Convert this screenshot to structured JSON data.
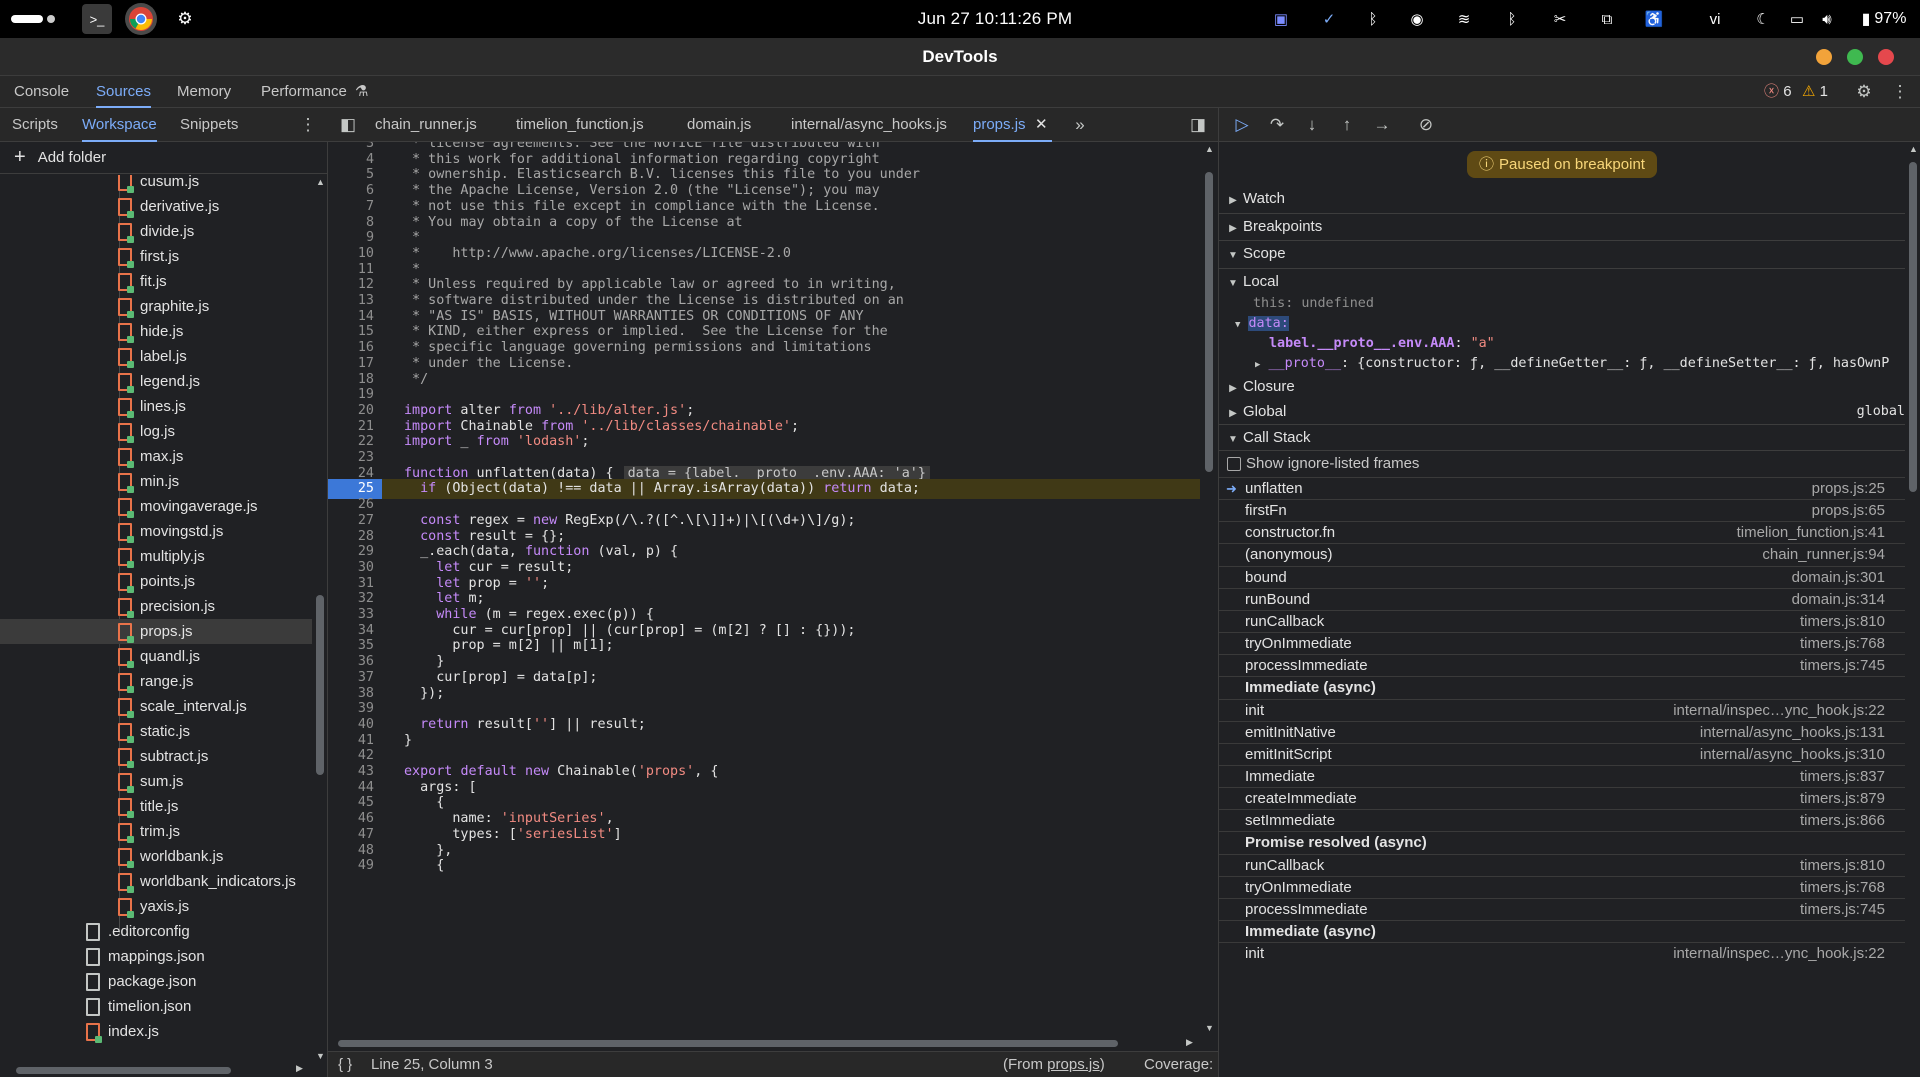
{
  "topbar": {
    "clock": "Jun 27  10:11:26 PM",
    "keyboard_layout": "vi",
    "battery": "97%"
  },
  "window": {
    "title": "DevTools",
    "colors": {
      "minimize": "#f2a33a",
      "maximize": "#3fb950",
      "close": "#e5484d"
    }
  },
  "main_tabs": [
    "Console",
    "Sources",
    "Memory",
    "Performance"
  ],
  "active_main_tab": "Sources",
  "counters": {
    "errors": "6",
    "warnings": "1"
  },
  "navigator": {
    "tabs": [
      "Scripts",
      "Workspace",
      "Snippets"
    ],
    "active_tab": "Workspace",
    "add_folder": "Add folder",
    "files": [
      {
        "name": "cusum.js",
        "type": "js"
      },
      {
        "name": "derivative.js",
        "type": "js"
      },
      {
        "name": "divide.js",
        "type": "js"
      },
      {
        "name": "first.js",
        "type": "js"
      },
      {
        "name": "fit.js",
        "type": "js"
      },
      {
        "name": "graphite.js",
        "type": "js"
      },
      {
        "name": "hide.js",
        "type": "js"
      },
      {
        "name": "label.js",
        "type": "js"
      },
      {
        "name": "legend.js",
        "type": "js"
      },
      {
        "name": "lines.js",
        "type": "js"
      },
      {
        "name": "log.js",
        "type": "js"
      },
      {
        "name": "max.js",
        "type": "js"
      },
      {
        "name": "min.js",
        "type": "js"
      },
      {
        "name": "movingaverage.js",
        "type": "js"
      },
      {
        "name": "movingstd.js",
        "type": "js"
      },
      {
        "name": "multiply.js",
        "type": "js"
      },
      {
        "name": "points.js",
        "type": "js"
      },
      {
        "name": "precision.js",
        "type": "js"
      },
      {
        "name": "props.js",
        "type": "js",
        "selected": true
      },
      {
        "name": "quandl.js",
        "type": "js"
      },
      {
        "name": "range.js",
        "type": "js"
      },
      {
        "name": "scale_interval.js",
        "type": "js"
      },
      {
        "name": "static.js",
        "type": "js"
      },
      {
        "name": "subtract.js",
        "type": "js"
      },
      {
        "name": "sum.js",
        "type": "js"
      },
      {
        "name": "title.js",
        "type": "js"
      },
      {
        "name": "trim.js",
        "type": "js"
      },
      {
        "name": "worldbank.js",
        "type": "js"
      },
      {
        "name": "worldbank_indicators.js",
        "type": "js"
      },
      {
        "name": "yaxis.js",
        "type": "js"
      },
      {
        "name": ".editorconfig",
        "type": "plain"
      },
      {
        "name": "mappings.json",
        "type": "plain"
      },
      {
        "name": "package.json",
        "type": "plain"
      },
      {
        "name": "timelion.json",
        "type": "plain"
      },
      {
        "name": "index.js",
        "type": "js"
      }
    ]
  },
  "editor": {
    "tabs": [
      "chain_runner.js",
      "timelion_function.js",
      "domain.js",
      "internal/async_hooks.js",
      "props.js"
    ],
    "active_tab": "props.js",
    "breakpoint_line": 25,
    "status": {
      "position": "Line 25, Column 3",
      "from_prefix": "(From ",
      "from_file": "props.js",
      "from_suffix": ")",
      "coverage": "Coverage: n/a"
    },
    "lines": [
      {
        "n": "3",
        "t": " * license agreements. See the NOTICE file distributed with",
        "c": "cm"
      },
      {
        "n": "4",
        "t": " * this work for additional information regarding copyright",
        "c": "cm"
      },
      {
        "n": "5",
        "t": " * ownership. Elasticsearch B.V. licenses this file to you under",
        "c": "cm"
      },
      {
        "n": "6",
        "t": " * the Apache License, Version 2.0 (the \"License\"); you may",
        "c": "cm"
      },
      {
        "n": "7",
        "t": " * not use this file except in compliance with the License.",
        "c": "cm"
      },
      {
        "n": "8",
        "t": " * You may obtain a copy of the License at",
        "c": "cm"
      },
      {
        "n": "9",
        "t": " *",
        "c": "cm"
      },
      {
        "n": "10",
        "t": " *    http://www.apache.org/licenses/LICENSE-2.0",
        "c": "cm"
      },
      {
        "n": "11",
        "t": " *",
        "c": "cm"
      },
      {
        "n": "12",
        "t": " * Unless required by applicable law or agreed to in writing,",
        "c": "cm"
      },
      {
        "n": "13",
        "t": " * software distributed under the License is distributed on an",
        "c": "cm"
      },
      {
        "n": "14",
        "t": " * \"AS IS\" BASIS, WITHOUT WARRANTIES OR CONDITIONS OF ANY",
        "c": "cm"
      },
      {
        "n": "15",
        "t": " * KIND, either express or implied.  See the License for the",
        "c": "cm"
      },
      {
        "n": "16",
        "t": " * specific language governing permissions and limitations",
        "c": "cm"
      },
      {
        "n": "17",
        "t": " * under the License.",
        "c": "cm"
      },
      {
        "n": "18",
        "t": " */",
        "c": "cm"
      },
      {
        "n": "19",
        "t": "",
        "c": ""
      },
      {
        "n": "20",
        "t": "import alter from '../lib/alter.js';",
        "c": "import"
      },
      {
        "n": "21",
        "t": "import Chainable from '../lib/classes/chainable';",
        "c": "import"
      },
      {
        "n": "22",
        "t": "import _ from 'lodash';",
        "c": "import"
      },
      {
        "n": "23",
        "t": "",
        "c": ""
      },
      {
        "n": "24",
        "t": "function unflatten(data) {",
        "c": "func",
        "inline": "data = {label.__proto__.env.AAA: 'a'}"
      },
      {
        "n": "25",
        "t": "  if (Object(data) !== data || Array.isArray(data)) return data;",
        "c": "bp"
      },
      {
        "n": "26",
        "t": "",
        "c": ""
      },
      {
        "n": "27",
        "t": "  const regex = new RegExp(/\\.?([^.\\[\\]]+)|\\[(\\d+)\\]/g);",
        "c": "code"
      },
      {
        "n": "28",
        "t": "  const result = {};",
        "c": "code"
      },
      {
        "n": "29",
        "t": "  _.each(data, function (val, p) {",
        "c": "code"
      },
      {
        "n": "30",
        "t": "    let cur = result;",
        "c": "code"
      },
      {
        "n": "31",
        "t": "    let prop = '';",
        "c": "code"
      },
      {
        "n": "32",
        "t": "    let m;",
        "c": "code"
      },
      {
        "n": "33",
        "t": "    while (m = regex.exec(p)) {",
        "c": "code"
      },
      {
        "n": "34",
        "t": "      cur = cur[prop] || (cur[prop] = (m[2] ? [] : {}));",
        "c": "code"
      },
      {
        "n": "35",
        "t": "      prop = m[2] || m[1];",
        "c": "code"
      },
      {
        "n": "36",
        "t": "    }",
        "c": "code"
      },
      {
        "n": "37",
        "t": "    cur[prop] = data[p];",
        "c": "code"
      },
      {
        "n": "38",
        "t": "  });",
        "c": "code"
      },
      {
        "n": "39",
        "t": "",
        "c": ""
      },
      {
        "n": "40",
        "t": "  return result[''] || result;",
        "c": "code"
      },
      {
        "n": "41",
        "t": "}",
        "c": "code"
      },
      {
        "n": "42",
        "t": "",
        "c": ""
      },
      {
        "n": "43",
        "t": "export default new Chainable('props', {",
        "c": "code"
      },
      {
        "n": "44",
        "t": "  args: [",
        "c": "code"
      },
      {
        "n": "45",
        "t": "    {",
        "c": "code"
      },
      {
        "n": "46",
        "t": "      name: 'inputSeries',",
        "c": "code"
      },
      {
        "n": "47",
        "t": "      types: ['seriesList']",
        "c": "code"
      },
      {
        "n": "48",
        "t": "    },",
        "c": "code"
      },
      {
        "n": "49",
        "t": "    {",
        "c": "code"
      }
    ]
  },
  "debugger": {
    "paused_message": "Paused on breakpoint",
    "sections": {
      "watch": "Watch",
      "breakpoints": "Breakpoints",
      "scope": "Scope",
      "local": "Local",
      "closure": "Closure",
      "global": "Global",
      "global_value": "global",
      "call_stack": "Call Stack"
    },
    "scope": {
      "this_key": "this:",
      "this_val": "undefined",
      "data_key": "data:",
      "data_prop": "label.__proto__.env.AAA",
      "data_prop_val": "\"a\"",
      "proto_key": "__proto__",
      "proto_val": "{constructor: ƒ, __defineGetter__: ƒ, __defineSetter__: ƒ, hasOwnP"
    },
    "show_ignored": "Show ignore-listed frames",
    "frames": [
      {
        "name": "unflatten",
        "loc": "props.js:25",
        "current": true
      },
      {
        "name": "firstFn",
        "loc": "props.js:65"
      },
      {
        "name": "constructor.fn",
        "loc": "timelion_function.js:41"
      },
      {
        "name": "(anonymous)",
        "loc": "chain_runner.js:94"
      },
      {
        "name": "bound",
        "loc": "domain.js:301"
      },
      {
        "name": "runBound",
        "loc": "domain.js:314"
      },
      {
        "name": "runCallback",
        "loc": "timers.js:810"
      },
      {
        "name": "tryOnImmediate",
        "loc": "timers.js:768"
      },
      {
        "name": "processImmediate",
        "loc": "timers.js:745"
      },
      {
        "name": "Immediate (async)",
        "loc": "",
        "async": true
      },
      {
        "name": "init",
        "loc": "internal/inspec…ync_hook.js:22"
      },
      {
        "name": "emitInitNative",
        "loc": "internal/async_hooks.js:131"
      },
      {
        "name": "emitInitScript",
        "loc": "internal/async_hooks.js:310"
      },
      {
        "name": "Immediate",
        "loc": "timers.js:837"
      },
      {
        "name": "createImmediate",
        "loc": "timers.js:879"
      },
      {
        "name": "setImmediate",
        "loc": "timers.js:866"
      },
      {
        "name": "Promise resolved (async)",
        "loc": "",
        "async": true
      },
      {
        "name": "runCallback",
        "loc": "timers.js:810"
      },
      {
        "name": "tryOnImmediate",
        "loc": "timers.js:768"
      },
      {
        "name": "processImmediate",
        "loc": "timers.js:745"
      },
      {
        "name": "Immediate (async)",
        "loc": "",
        "async": true
      },
      {
        "name": "init",
        "loc": "internal/inspec…ync_hook.js:22"
      }
    ]
  }
}
